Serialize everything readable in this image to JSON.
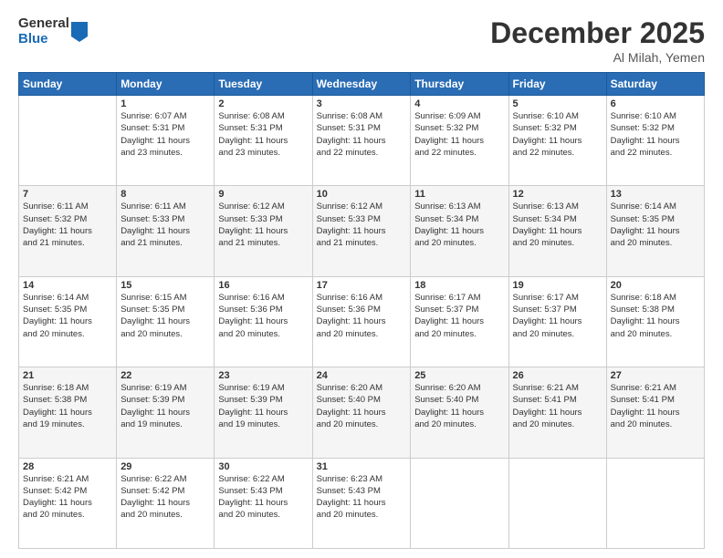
{
  "logo": {
    "general": "General",
    "blue": "Blue"
  },
  "header": {
    "month": "December 2025",
    "location": "Al Milah, Yemen"
  },
  "days_of_week": [
    "Sunday",
    "Monday",
    "Tuesday",
    "Wednesday",
    "Thursday",
    "Friday",
    "Saturday"
  ],
  "weeks": [
    [
      {
        "day": "",
        "info": ""
      },
      {
        "day": "1",
        "info": "Sunrise: 6:07 AM\nSunset: 5:31 PM\nDaylight: 11 hours\nand 23 minutes."
      },
      {
        "day": "2",
        "info": "Sunrise: 6:08 AM\nSunset: 5:31 PM\nDaylight: 11 hours\nand 23 minutes."
      },
      {
        "day": "3",
        "info": "Sunrise: 6:08 AM\nSunset: 5:31 PM\nDaylight: 11 hours\nand 22 minutes."
      },
      {
        "day": "4",
        "info": "Sunrise: 6:09 AM\nSunset: 5:32 PM\nDaylight: 11 hours\nand 22 minutes."
      },
      {
        "day": "5",
        "info": "Sunrise: 6:10 AM\nSunset: 5:32 PM\nDaylight: 11 hours\nand 22 minutes."
      },
      {
        "day": "6",
        "info": "Sunrise: 6:10 AM\nSunset: 5:32 PM\nDaylight: 11 hours\nand 22 minutes."
      }
    ],
    [
      {
        "day": "7",
        "info": "Sunrise: 6:11 AM\nSunset: 5:32 PM\nDaylight: 11 hours\nand 21 minutes."
      },
      {
        "day": "8",
        "info": "Sunrise: 6:11 AM\nSunset: 5:33 PM\nDaylight: 11 hours\nand 21 minutes."
      },
      {
        "day": "9",
        "info": "Sunrise: 6:12 AM\nSunset: 5:33 PM\nDaylight: 11 hours\nand 21 minutes."
      },
      {
        "day": "10",
        "info": "Sunrise: 6:12 AM\nSunset: 5:33 PM\nDaylight: 11 hours\nand 21 minutes."
      },
      {
        "day": "11",
        "info": "Sunrise: 6:13 AM\nSunset: 5:34 PM\nDaylight: 11 hours\nand 20 minutes."
      },
      {
        "day": "12",
        "info": "Sunrise: 6:13 AM\nSunset: 5:34 PM\nDaylight: 11 hours\nand 20 minutes."
      },
      {
        "day": "13",
        "info": "Sunrise: 6:14 AM\nSunset: 5:35 PM\nDaylight: 11 hours\nand 20 minutes."
      }
    ],
    [
      {
        "day": "14",
        "info": "Sunrise: 6:14 AM\nSunset: 5:35 PM\nDaylight: 11 hours\nand 20 minutes."
      },
      {
        "day": "15",
        "info": "Sunrise: 6:15 AM\nSunset: 5:35 PM\nDaylight: 11 hours\nand 20 minutes."
      },
      {
        "day": "16",
        "info": "Sunrise: 6:16 AM\nSunset: 5:36 PM\nDaylight: 11 hours\nand 20 minutes."
      },
      {
        "day": "17",
        "info": "Sunrise: 6:16 AM\nSunset: 5:36 PM\nDaylight: 11 hours\nand 20 minutes."
      },
      {
        "day": "18",
        "info": "Sunrise: 6:17 AM\nSunset: 5:37 PM\nDaylight: 11 hours\nand 20 minutes."
      },
      {
        "day": "19",
        "info": "Sunrise: 6:17 AM\nSunset: 5:37 PM\nDaylight: 11 hours\nand 20 minutes."
      },
      {
        "day": "20",
        "info": "Sunrise: 6:18 AM\nSunset: 5:38 PM\nDaylight: 11 hours\nand 20 minutes."
      }
    ],
    [
      {
        "day": "21",
        "info": "Sunrise: 6:18 AM\nSunset: 5:38 PM\nDaylight: 11 hours\nand 19 minutes."
      },
      {
        "day": "22",
        "info": "Sunrise: 6:19 AM\nSunset: 5:39 PM\nDaylight: 11 hours\nand 19 minutes."
      },
      {
        "day": "23",
        "info": "Sunrise: 6:19 AM\nSunset: 5:39 PM\nDaylight: 11 hours\nand 19 minutes."
      },
      {
        "day": "24",
        "info": "Sunrise: 6:20 AM\nSunset: 5:40 PM\nDaylight: 11 hours\nand 20 minutes."
      },
      {
        "day": "25",
        "info": "Sunrise: 6:20 AM\nSunset: 5:40 PM\nDaylight: 11 hours\nand 20 minutes."
      },
      {
        "day": "26",
        "info": "Sunrise: 6:21 AM\nSunset: 5:41 PM\nDaylight: 11 hours\nand 20 minutes."
      },
      {
        "day": "27",
        "info": "Sunrise: 6:21 AM\nSunset: 5:41 PM\nDaylight: 11 hours\nand 20 minutes."
      }
    ],
    [
      {
        "day": "28",
        "info": "Sunrise: 6:21 AM\nSunset: 5:42 PM\nDaylight: 11 hours\nand 20 minutes."
      },
      {
        "day": "29",
        "info": "Sunrise: 6:22 AM\nSunset: 5:42 PM\nDaylight: 11 hours\nand 20 minutes."
      },
      {
        "day": "30",
        "info": "Sunrise: 6:22 AM\nSunset: 5:43 PM\nDaylight: 11 hours\nand 20 minutes."
      },
      {
        "day": "31",
        "info": "Sunrise: 6:23 AM\nSunset: 5:43 PM\nDaylight: 11 hours\nand 20 minutes."
      },
      {
        "day": "",
        "info": ""
      },
      {
        "day": "",
        "info": ""
      },
      {
        "day": "",
        "info": ""
      }
    ]
  ]
}
